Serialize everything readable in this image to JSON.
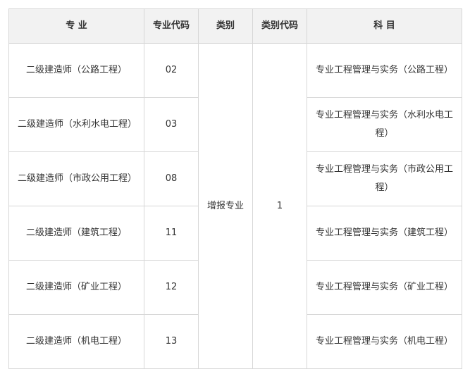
{
  "table": {
    "headers": {
      "major": "专  业",
      "major_code": "专业代码",
      "category": "类别",
      "category_code": "类别代码",
      "subject": "科    目"
    },
    "category_value": "增报专业",
    "category_code_value": "1",
    "rows": [
      {
        "major": "二级建造师（公路工程）",
        "code": "02",
        "subject": "专业工程管理与实务（公路工程）"
      },
      {
        "major": "二级建造师（水利水电工程）",
        "code": "03",
        "subject": "专业工程管理与实务（水利水电工程）"
      },
      {
        "major": "二级建造师（市政公用工程）",
        "code": "08",
        "subject": "专业工程管理与实务（市政公用工程）"
      },
      {
        "major": "二级建造师（建筑工程）",
        "code": "11",
        "subject": "专业工程管理与实务（建筑工程）"
      },
      {
        "major": "二级建造师（矿业工程）",
        "code": "12",
        "subject": "专业工程管理与实务（矿业工程）"
      },
      {
        "major": "二级建造师（机电工程）",
        "code": "13",
        "subject": "专业工程管理与实务（机电工程）"
      }
    ]
  }
}
